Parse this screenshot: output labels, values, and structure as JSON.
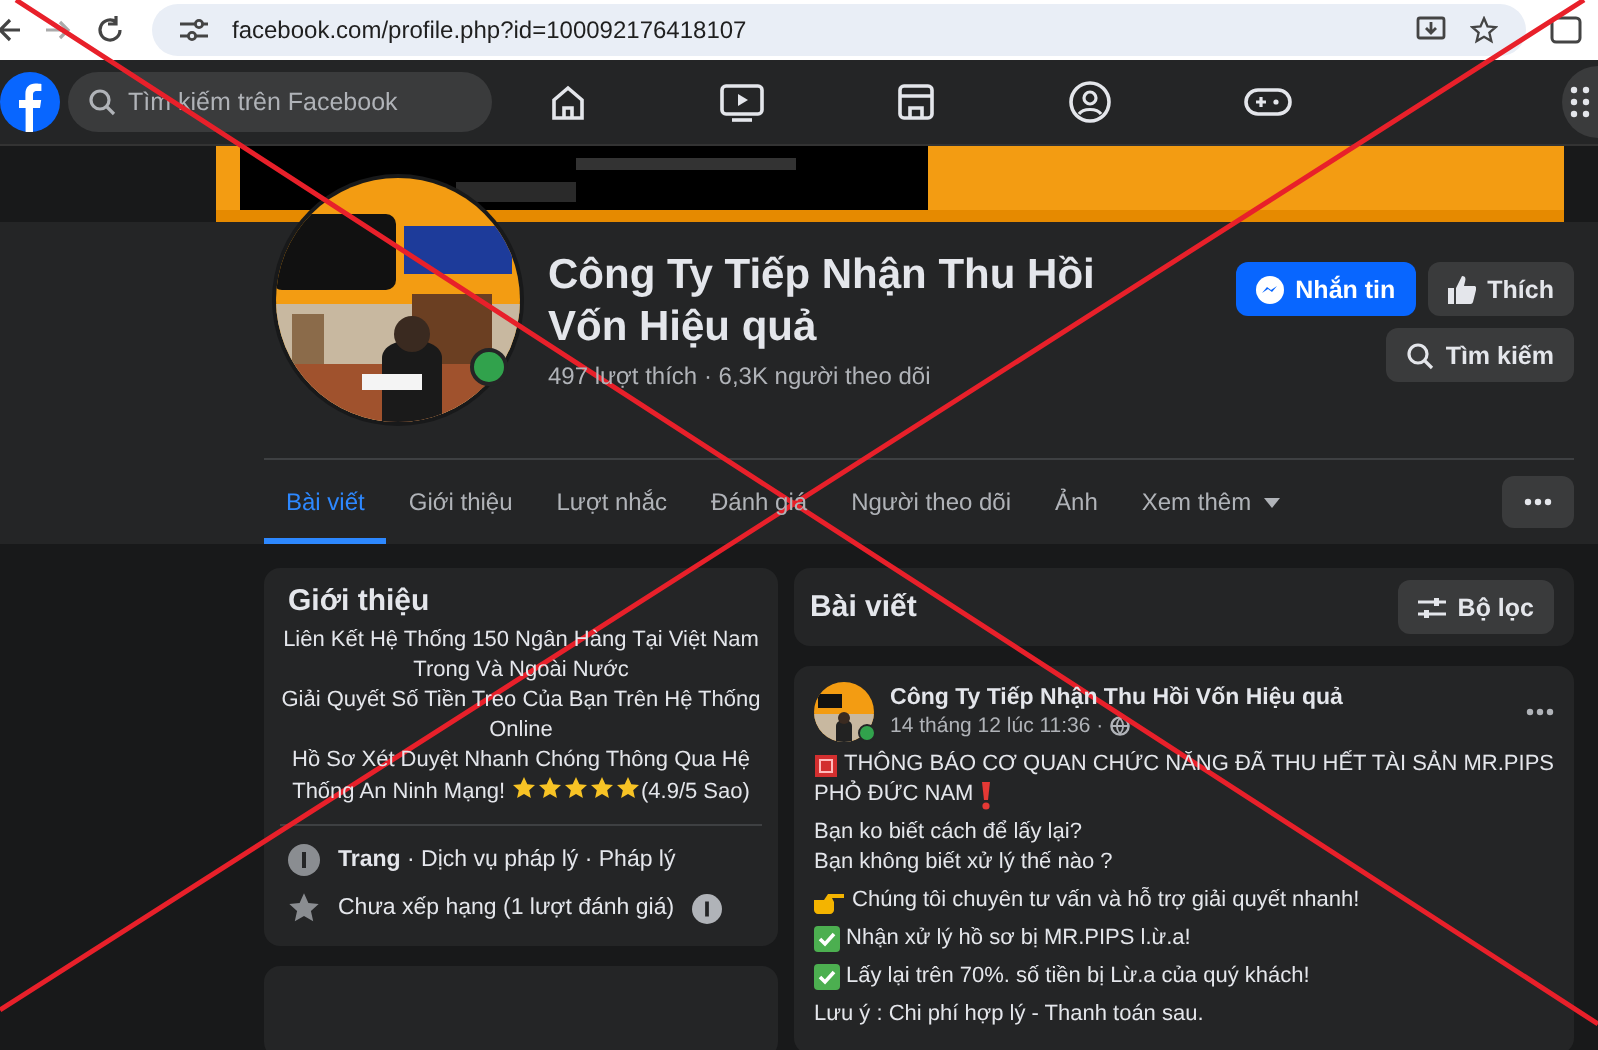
{
  "browser": {
    "url": "facebook.com/profile.php?id=100092176418107"
  },
  "nav": {
    "search": {
      "placeholder": "Tìm kiếm trên Facebook"
    }
  },
  "profile": {
    "name": "Công Ty Tiếp Nhận Thu Hồi Vốn Hiệu quả",
    "stats": "497 lượt thích · 6,3K người theo dõi",
    "online": true,
    "buttons": [
      {
        "kind": "message",
        "label": "Nhắn tin"
      },
      {
        "kind": "like",
        "label": "Thích"
      },
      {
        "kind": "search",
        "label": "Tìm kiếm"
      }
    ]
  },
  "tabs": [
    {
      "label": "Bài viết",
      "selected": true
    },
    {
      "label": "Giới thiệu",
      "selected": false
    },
    {
      "label": "Lượt nhắc",
      "selected": false
    },
    {
      "label": "Đánh giá",
      "selected": false
    },
    {
      "label": "Người theo dõi",
      "selected": false
    },
    {
      "label": "Ảnh",
      "selected": false
    },
    {
      "label": "Xem thêm",
      "selected": false,
      "dropdown": true
    }
  ],
  "intro": {
    "title": "Giới thiệu",
    "lines": [
      "Liên Kết Hệ Thống 150 Ngân Hàng Tại Việt Nam Trong Và Ngoài Nước",
      "Giải Quyết Số Tiền Treo Của Bạn Trên Hệ Thống Online"
    ],
    "last_line": "Hồ Sơ Xét Duyệt Nhanh Chóng Thông Qua Hệ",
    "last_line_end": "Thống An Ninh Mạng!",
    "stars": 5,
    "rating": "(4.9/5 Sao)",
    "details": [
      {
        "kind": "info",
        "label": "Trang",
        "text": " · Dịch vụ pháp lý · Pháp lý"
      },
      {
        "kind": "star",
        "text": "Chưa xếp hạng (1 lượt đánh giá)",
        "info": true
      }
    ]
  },
  "posts_header": {
    "title": "Bài viết",
    "filter": "Bộ lọc"
  },
  "post": {
    "author": "Công Ty Tiếp Nhận Thu Hồi Vốn Hiệu quả",
    "time": "14 tháng 12 lúc 11:36 ·",
    "online": true,
    "paragraphs": [
      [
        {
          "kind": "alert",
          "text": "THÔNG BÁO CƠ QUAN CHỨC NĂNG ĐÃ THU HẾT TÀI SẢN MR.PIPS"
        },
        {
          "kind": "exclaim",
          "text": "PHỎ ĐỨC NAM"
        }
      ],
      [
        {
          "kind": "plain",
          "text": "Bạn ko biết cách để lấy lại?"
        },
        {
          "kind": "plain",
          "text": "Bạn không biết xử lý thế nào ?"
        }
      ],
      [
        {
          "kind": "pointing",
          "text": "Chúng tôi chuyên tư vấn và hỗ trợ giải quyết nhanh!"
        }
      ],
      [
        {
          "kind": "check",
          "text": "Nhận xử lý hồ sơ bị MR.PIPS l.ừ.a!"
        }
      ],
      [
        {
          "kind": "check",
          "text": "Lấy lại trên 70%. số tiền bị Lừ.a của quý khách!"
        }
      ],
      [
        {
          "kind": "plain",
          "text": "Lưu ý : Chi phí hợp lý - Thanh toán sau."
        }
      ]
    ]
  }
}
